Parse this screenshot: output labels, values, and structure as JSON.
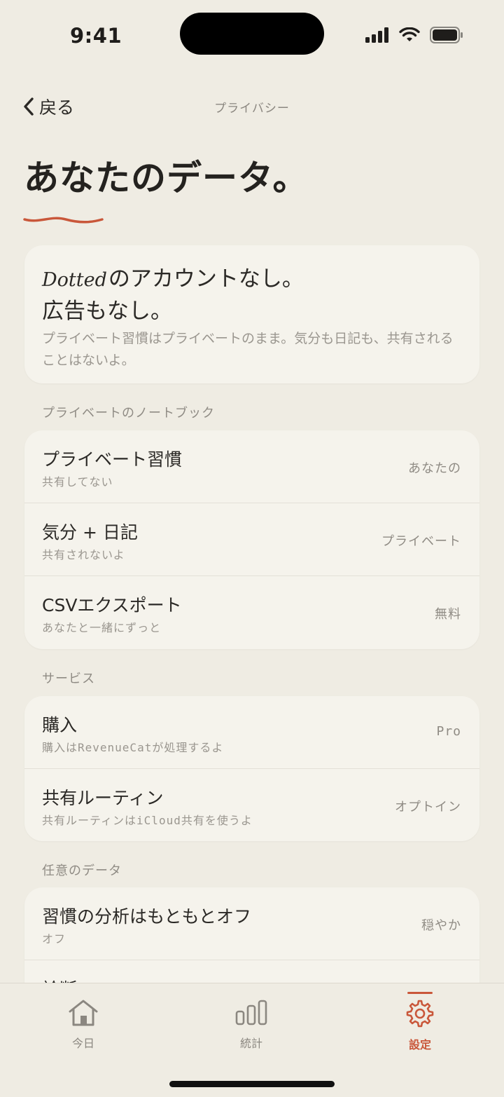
{
  "status_bar": {
    "time": "9:41"
  },
  "nav": {
    "back_label": "戻る",
    "title": "プライバシー"
  },
  "page_title": "あなたのデータ。",
  "hero": {
    "brand": "Dotted",
    "line1_rest": "のアカウントなし。",
    "line2": "広告もなし。",
    "description": "プライベート習慣はプライベートのまま。気分も日記も、共有されることはないよ。"
  },
  "sections": [
    {
      "label": "プライベートのノートブック",
      "rows": [
        {
          "title": "プライベート習慣",
          "subtitle": "共有してない",
          "value": "あなたの"
        },
        {
          "title": "気分 + 日記",
          "subtitle": "共有されないよ",
          "value": "プライベート"
        },
        {
          "title": "CSVエクスポート",
          "subtitle": "あなたと一緒にずっと",
          "value": "無料"
        }
      ]
    },
    {
      "label": "サービス",
      "rows": [
        {
          "title": "購入",
          "subtitle": "購入はRevenueCatが処理するよ",
          "value": "Pro"
        },
        {
          "title": "共有ルーティン",
          "subtitle": "共有ルーティンはiCloud共有を使うよ",
          "value": "オプトイン"
        }
      ]
    },
    {
      "label": "任意のデータ",
      "rows": [
        {
          "title": "習慣の分析はもともとオフ",
          "subtitle": "オフ",
          "value": "穏やか"
        },
        {
          "title": "診断",
          "subtitle": "",
          "value": ""
        }
      ]
    }
  ],
  "tabs": [
    {
      "label": "今日",
      "icon": "home-icon"
    },
    {
      "label": "統計",
      "icon": "bar-chart-icon"
    },
    {
      "label": "設定",
      "icon": "gear-icon",
      "active": true
    }
  ],
  "colors": {
    "accent": "#c9573a",
    "background": "#efece3",
    "card": "#f5f3ec"
  }
}
